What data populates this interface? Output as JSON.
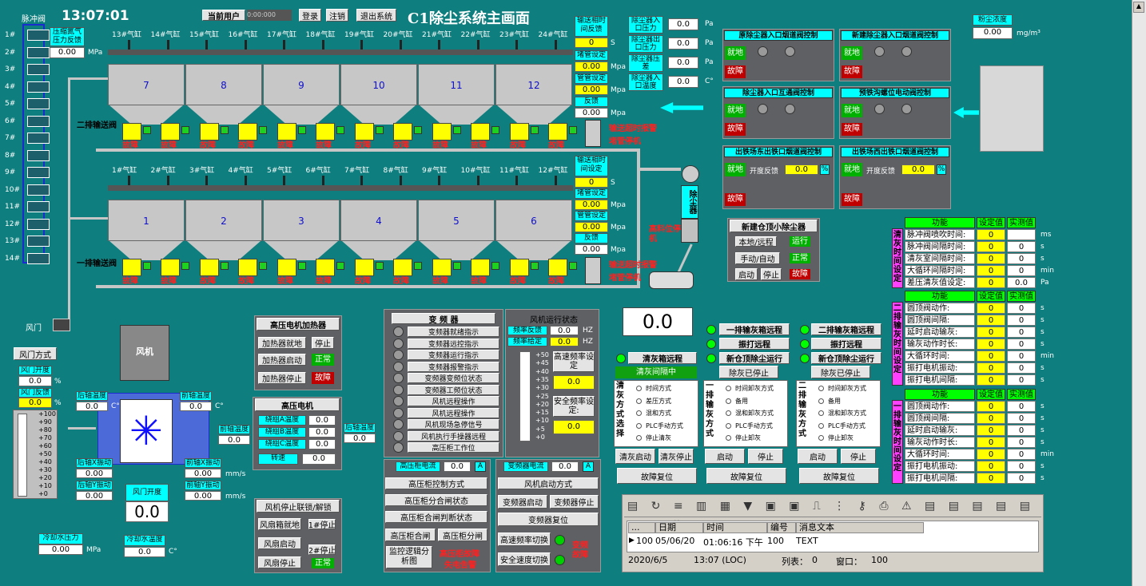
{
  "header": {
    "clock": "13:07:01",
    "user_label": "当前用户",
    "user_value": "0:00:000",
    "login": "登录",
    "logout": "注销",
    "exit": "退出系统",
    "title": "C1除尘系统主画面"
  },
  "pulse": {
    "title": "脉冲阀",
    "rows": [
      "1#",
      "2#",
      "3#",
      "4#",
      "5#",
      "6#",
      "7#",
      "8#",
      "9#",
      "10#",
      "11#",
      "12#",
      "13#",
      "14#"
    ]
  },
  "compressed": {
    "label": "压缩氮气压力反馈",
    "value": "0.00",
    "unit": "MPa"
  },
  "row2": {
    "cylinders": [
      "13#气缸",
      "14#气缸",
      "15#气缸",
      "16#气缸",
      "17#气缸",
      "18#气缸",
      "19#气缸",
      "20#气缸",
      "21#气缸",
      "22#气缸",
      "23#气缸",
      "24#气缸"
    ],
    "hoppers": [
      "7",
      "8",
      "9",
      "10",
      "11",
      "12"
    ],
    "valve_label": "二排输送阀"
  },
  "row1": {
    "cylinders": [
      "1#气缸",
      "2#气缸",
      "3#气缸",
      "4#气缸",
      "5#气缸",
      "6#气缸",
      "7#气缸",
      "8#气缸",
      "9#气缸",
      "10#气缸",
      "11#气缸",
      "12#气缸"
    ],
    "hoppers": [
      "1",
      "2",
      "3",
      "4",
      "5",
      "6"
    ],
    "valve_label": "一排输送阀"
  },
  "fault": "故障",
  "convey2": {
    "t1": "输送相时间反馈",
    "t1v": "0",
    "t1u": "S",
    "t2": "堵管设定",
    "t2v": "0.00",
    "t2u": "Mpa",
    "t3": "管管设定",
    "t3v": "0.00",
    "t3u": "Mpa",
    "t4": "反馈",
    "t4v": "0.00",
    "t4u": "Mpa",
    "alarm1": "输送超时报警",
    "alarm2": "堵管停机"
  },
  "convey1": {
    "t1": "输送相时间设定",
    "t1v": "0",
    "t1u": "S",
    "t2": "堵管设定",
    "t2v": "0.00",
    "t2u": "Mpa",
    "t3": "管管设定",
    "t3v": "0.00",
    "t3u": "Mpa",
    "t4": "反馈",
    "t4v": "0.00",
    "t4u": "Mpa",
    "alarm1": "输送超时报警",
    "alarm2": "堵管停机"
  },
  "duster_params": [
    {
      "label": "除尘器入口压力",
      "value": "0.0",
      "unit": "Pa"
    },
    {
      "label": "除尘器出口压力",
      "value": "0.0",
      "unit": "Pa"
    },
    {
      "label": "除尘器压差",
      "value": "0.0",
      "unit": "Pa"
    },
    {
      "label": "除尘器入口温度",
      "value": "0.0",
      "unit": "C°"
    }
  ],
  "duster": {
    "label": "除尘器",
    "high_level": "高料位停机"
  },
  "dust": {
    "label": "粉尘浓度",
    "value": "0.00",
    "unit": "mg/m³"
  },
  "dampers": [
    {
      "title": "原除尘器入口烟道阀控制",
      "local": "就地",
      "fault": "故障"
    },
    {
      "title": "新建除尘器入口烟道阀控制",
      "local": "就地",
      "fault": "故障"
    },
    {
      "title": "除尘器入口互通阀控制",
      "local": "就地",
      "fault": "故障"
    },
    {
      "title": "预铁沟螺位电动阀控制",
      "local": "就地",
      "fault": "故障"
    }
  ],
  "dampers2": [
    {
      "title": "出铁场东出铁口烟道阀控制",
      "local": "就地",
      "fault": "故障",
      "fb": "开度反馈",
      "value": "0.0",
      "unit": "%"
    },
    {
      "title": "出铁场西出铁口烟道阀控制",
      "local": "就地",
      "fault": "故障",
      "fb": "开度反馈",
      "value": "0.0",
      "unit": "%"
    }
  ],
  "small": {
    "title": "新建仓顶小除尘器",
    "local": "本地/远程",
    "run": "运行",
    "manual": "手动/自动",
    "normal": "正常",
    "start": "启动",
    "stop": "停止",
    "fault": "故障"
  },
  "clean": {
    "title": "功能",
    "set": "设定值",
    "act": "实测值",
    "side": "清灰时间设定",
    "rows": [
      {
        "n": "脉冲阀喷吹时间:",
        "s": "0",
        "a": "",
        "u": "ms"
      },
      {
        "n": "脉冲阀间隔时间:",
        "s": "0",
        "a": "0",
        "u": "s"
      },
      {
        "n": "清灰室间隔时间:",
        "s": "0",
        "a": "0",
        "u": "s"
      },
      {
        "n": "大循环间隔时间:",
        "s": "0",
        "a": "0",
        "u": "min"
      },
      {
        "n": "差压清灰值设定:",
        "s": "0",
        "a": "0.0",
        "u": "Pa"
      }
    ]
  },
  "ash2": {
    "title": "功能",
    "set": "设定值",
    "act": "实测值",
    "side": "二排输灰时间设定",
    "rows": [
      {
        "n": "圆顶阀动作:",
        "s": "0",
        "a": "0",
        "u": "s"
      },
      {
        "n": "圆顶阀间隔:",
        "s": "0",
        "a": "0",
        "u": "s"
      },
      {
        "n": "延时启动输灰:",
        "s": "0",
        "a": "0",
        "u": "s"
      },
      {
        "n": "输灰动作时长:",
        "s": "0",
        "a": "0",
        "u": "s"
      },
      {
        "n": "大循环时间:",
        "s": "0",
        "a": "0",
        "u": "min"
      },
      {
        "n": "振打电机振动:",
        "s": "0",
        "a": "0",
        "u": "s"
      },
      {
        "n": "振打电机间隔:",
        "s": "0",
        "a": "0",
        "u": "s"
      }
    ]
  },
  "ash1": {
    "title": "功能",
    "set": "设定值",
    "act": "实测值",
    "side": "一排输灰时间设定",
    "rows": [
      {
        "n": "圆顶阀动作:",
        "s": "0",
        "a": "0",
        "u": "s"
      },
      {
        "n": "圆顶阀间隔:",
        "s": "0",
        "a": "0",
        "u": "s"
      },
      {
        "n": "延时启动输灰:",
        "s": "0",
        "a": "0",
        "u": "s"
      },
      {
        "n": "输灰动作时长:",
        "s": "0",
        "a": "0",
        "u": "s"
      },
      {
        "n": "大循环时间:",
        "s": "0",
        "a": "0",
        "u": "min"
      },
      {
        "n": "振打电机振动:",
        "s": "0",
        "a": "0",
        "u": "s"
      },
      {
        "n": "振打电机间隔:",
        "s": "0",
        "a": "0",
        "u": "s"
      }
    ]
  },
  "fan": {
    "label": "风机",
    "door_label": "风门",
    "door_mode": "风门方式",
    "door_open": "风门开度",
    "door_open_v": "0.0",
    "door_fb": "风门反馈",
    "door_fb_v": "0.0",
    "pct": "%",
    "front_temp": "前轴温度",
    "rear_temp": "后轴温度",
    "xvib": "后轴X振动",
    "yvib": "后轴Y振动",
    "fxvib": "前轴X振动",
    "fyvib": "前轴Y振动",
    "v": "0.00",
    "c": "C°",
    "mms": "mm/s",
    "temp_v": "0.0",
    "fan_open": "风门开度",
    "fan_open_v": "0.0",
    "water_p": "冷却水压力",
    "water_p_v": "0.00",
    "water_pu": "MPa",
    "water_t": "冷却水温度",
    "water_t_v": "0.0",
    "water_tu": "C°",
    "scale": [
      "+100",
      "+90",
      "+80",
      "+70",
      "+60",
      "+50",
      "+40",
      "+30",
      "+20",
      "+10",
      "+0"
    ]
  },
  "heater": {
    "title": "高压电机加热器",
    "b1": "加热器就地",
    "s1": "停止",
    "b2": "加热器启动",
    "s2": "正常",
    "b3": "加热器停止",
    "s3": "故障"
  },
  "motor": {
    "title": "高压电机",
    "a": "绕组A温度",
    "b": "绕组B温度",
    "c": "绕组C温度",
    "v": "0.0",
    "speed": "转速",
    "speed_v": "0.0",
    "ft": "前轴温度",
    "rt": "后轴温度"
  },
  "fanctl": {
    "title": "风机停止联锁/解锁",
    "b1": "风扇箱就地",
    "s1": "1#停止",
    "b2": "风扇启动",
    "s2": "2#停止",
    "b3": "风扇停止",
    "s3": "正常"
  },
  "vfd": {
    "title": "变 频 器",
    "items": [
      "变频器就绪指示",
      "变频器远控指示",
      "变频器运行指示",
      "变频器报警指示",
      "变频器变频位状态",
      "变频器工频位状态",
      "风机远程操作",
      "风机远程操作",
      "风机现场急停信号",
      "风机执行手操器远程",
      "高压柜工作位"
    ],
    "run": "风机运行状态",
    "freq_fb": "频率反馈",
    "freq_fb_v": "0.0",
    "freq_set": "频率给定",
    "freq_set_v": "0.0",
    "hz": "HZ",
    "scale": [
      "+50",
      "+45",
      "+40",
      "+35",
      "+30",
      "+25",
      "+20",
      "+15",
      "+10",
      "+5",
      "+0"
    ],
    "hs": "高速频率设定",
    "hs_v": "0.0",
    "ss": "安全频率设定:",
    "ss_v": "0.0"
  },
  "hv": {
    "cur": "高压柜电流",
    "cur_v": "0.0",
    "a": "A",
    "b1": "高压柜控制方式",
    "b2": "高压柜分合闸状态",
    "b3": "高压柜合闸判断状态",
    "close": "高压柜合闸",
    "open": "高压柜分闸",
    "logic": "监控逻辑分析图",
    "fault1": "高压柜故障",
    "fault2": "失电告警"
  },
  "vcur": {
    "cur": "变频器电流",
    "cur_v": "0.0",
    "a": "A",
    "b1": "风机启动方式",
    "start": "变频器启动",
    "stop": "变频器停止",
    "reset": "变频器复位",
    "hs": "高速频率切换",
    "ss": "安全速度切换",
    "fault": "变频故障"
  },
  "bigval": "0.0",
  "remote": {
    "r1": "一排输灰箱远程",
    "r2": "二排输灰箱远程",
    "r3": "振打远程",
    "r4": "振打远程",
    "r5": "新仓顶除尘运行",
    "r6": "新仓顶除尘运行",
    "clean_r": "清灰箱远程",
    "clean_int": "清灰间隔中",
    "dust_stop": "除灰已停止"
  },
  "mode": {
    "clean_side": "清灰方式选择",
    "a1_side": "一排输灰方式",
    "a2_side": "二排输灰方式",
    "clean_opts": [
      "时间方式",
      "差压方式",
      "混和方式",
      "PLC手动方式",
      "停止清灰"
    ],
    "ash_opts": [
      "时间卸灰方式",
      "备用",
      "混和卸灰方式",
      "PLC手动方式",
      "停止卸灰"
    ],
    "clean_start": "清灰启动",
    "clean_stop": "清灰停止",
    "start": "启动",
    "stop": "停止",
    "reset": "故障复位"
  },
  "alarm": {
    "cols": [
      "...",
      "日期",
      "时间",
      "编号",
      "消息文本"
    ],
    "row": [
      "100",
      "05/06/20",
      "01:06:16 下午",
      "100",
      "TEXT"
    ],
    "date": "2020/6/5",
    "time": "13:07 (LOC)",
    "list": "列表：",
    "list_v": "0",
    "win": "窗口：",
    "win_v": "100"
  },
  "colors": {
    "bg": "#0e7e7e",
    "cyan": "#00ffff",
    "green": "#00ff00",
    "yellow": "#ffff00",
    "red": "#ff2020"
  }
}
